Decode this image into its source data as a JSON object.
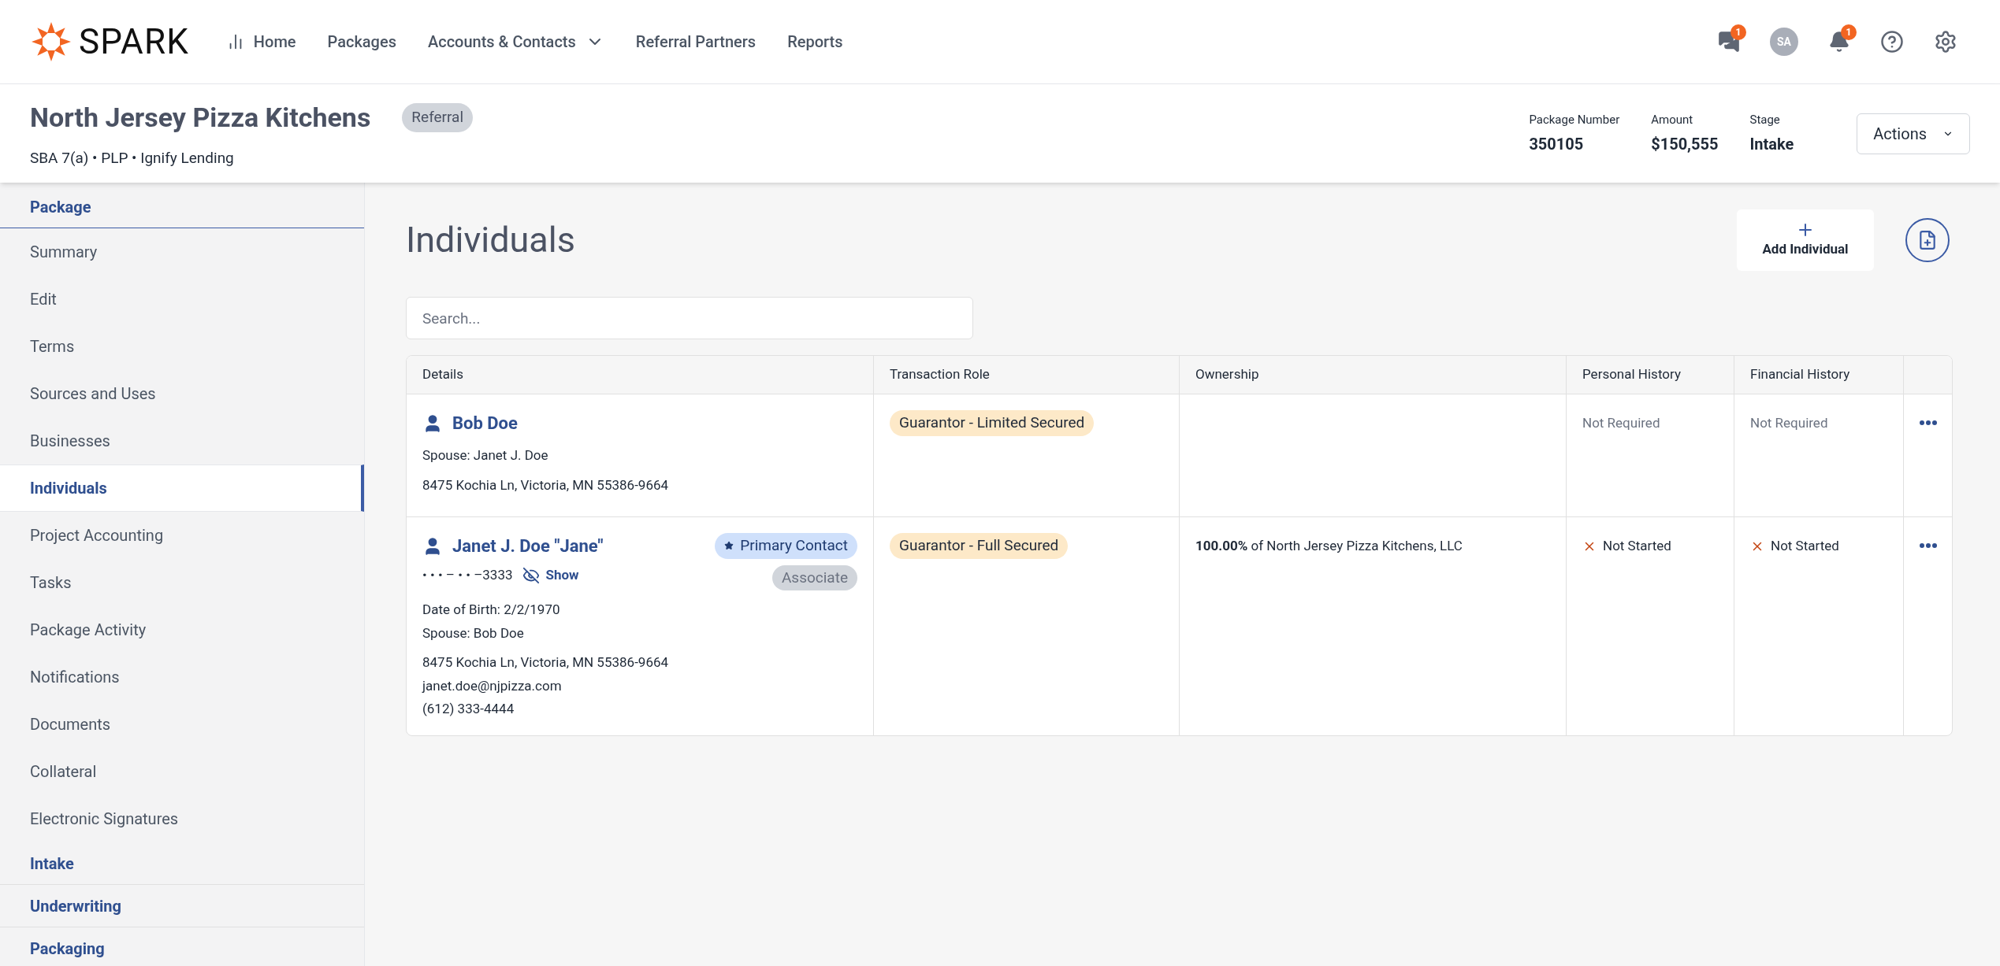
{
  "brand": {
    "name": "SPARK"
  },
  "nav": [
    {
      "label": "Home",
      "kind": "icon"
    },
    {
      "label": "Packages",
      "kind": "plain"
    },
    {
      "label": "Accounts & Contacts",
      "kind": "dropdown"
    },
    {
      "label": "Referral Partners",
      "kind": "plain"
    },
    {
      "label": "Reports",
      "kind": "plain"
    }
  ],
  "header_icons": [
    {
      "kind": "messages",
      "badge": "1"
    },
    {
      "kind": "avatar",
      "initials": "SA"
    },
    {
      "kind": "bell",
      "badge": "1"
    },
    {
      "kind": "help"
    },
    {
      "kind": "settings"
    }
  ],
  "package": {
    "title": "North Jersey Pizza Kitchens",
    "tag": "Referral",
    "subtitle": "SBA 7(a) • PLP • Ignify Lending",
    "stats": [
      {
        "label": "Package Number",
        "value": "350105"
      },
      {
        "label": "Amount",
        "value": "$150,555"
      },
      {
        "label": "Stage",
        "value": "Intake"
      }
    ],
    "actions": "Actions"
  },
  "sidebar": [
    {
      "label": "Package",
      "items": [
        {
          "label": "Summary",
          "selected": false
        },
        {
          "label": "Edit",
          "selected": false
        },
        {
          "label": "Terms",
          "selected": false
        },
        {
          "label": "Sources and Uses",
          "selected": false
        },
        {
          "label": "Businesses",
          "selected": false
        },
        {
          "label": "Individuals",
          "selected": true
        },
        {
          "label": "Project Accounting",
          "selected": false
        },
        {
          "label": "Tasks",
          "selected": false
        },
        {
          "label": "Package Activity",
          "selected": false
        },
        {
          "label": "Notifications",
          "selected": false
        },
        {
          "label": "Documents",
          "selected": false
        },
        {
          "label": "Collateral",
          "selected": false
        },
        {
          "label": "Electronic Signatures",
          "selected": false
        }
      ]
    },
    {
      "label": "Intake"
    },
    {
      "label": "Underwriting"
    },
    {
      "label": "Packaging"
    }
  ],
  "page_title": "Individuals",
  "add_button": "Add Individual",
  "search": {
    "placeholder": "Search..."
  },
  "table": {
    "columns": [
      "Details",
      "Transaction Role",
      "Ownership",
      "Personal History",
      "Financial History"
    ],
    "rows": [
      {
        "name": "Bob Doe",
        "details": [
          [
            "Spouse: Janet J. Doe"
          ],
          [
            "8475 Kochia Ln, Victoria, MN 55386-9664"
          ]
        ],
        "role": "Guarantor - Limited Secured",
        "personal_history": {
          "status": "Not Required",
          "kind": "not_required"
        },
        "financial_history": {
          "status": "Not Required",
          "kind": "not_required"
        }
      },
      {
        "name": "Janet J. Doe \"Jane\"",
        "primary_contact": "Primary Contact",
        "tag": "Associate",
        "ssn": "• • • – • • –3333",
        "show": "Show",
        "details": [
          [
            "Date of Birth: 2/2/1970",
            "Spouse: Bob Doe"
          ],
          [
            "8475 Kochia Ln, Victoria, MN 55386-9664",
            "janet.doe@njpizza.com",
            "(612) 333-4444"
          ]
        ],
        "role": "Guarantor - Full Secured",
        "ownership": "**100.00%** of North Jersey Pizza Kitchens, LLC",
        "personal_history": {
          "status": "Not Started",
          "kind": "not_started"
        },
        "financial_history": {
          "status": "Not Started",
          "kind": "not_started"
        }
      }
    ]
  }
}
